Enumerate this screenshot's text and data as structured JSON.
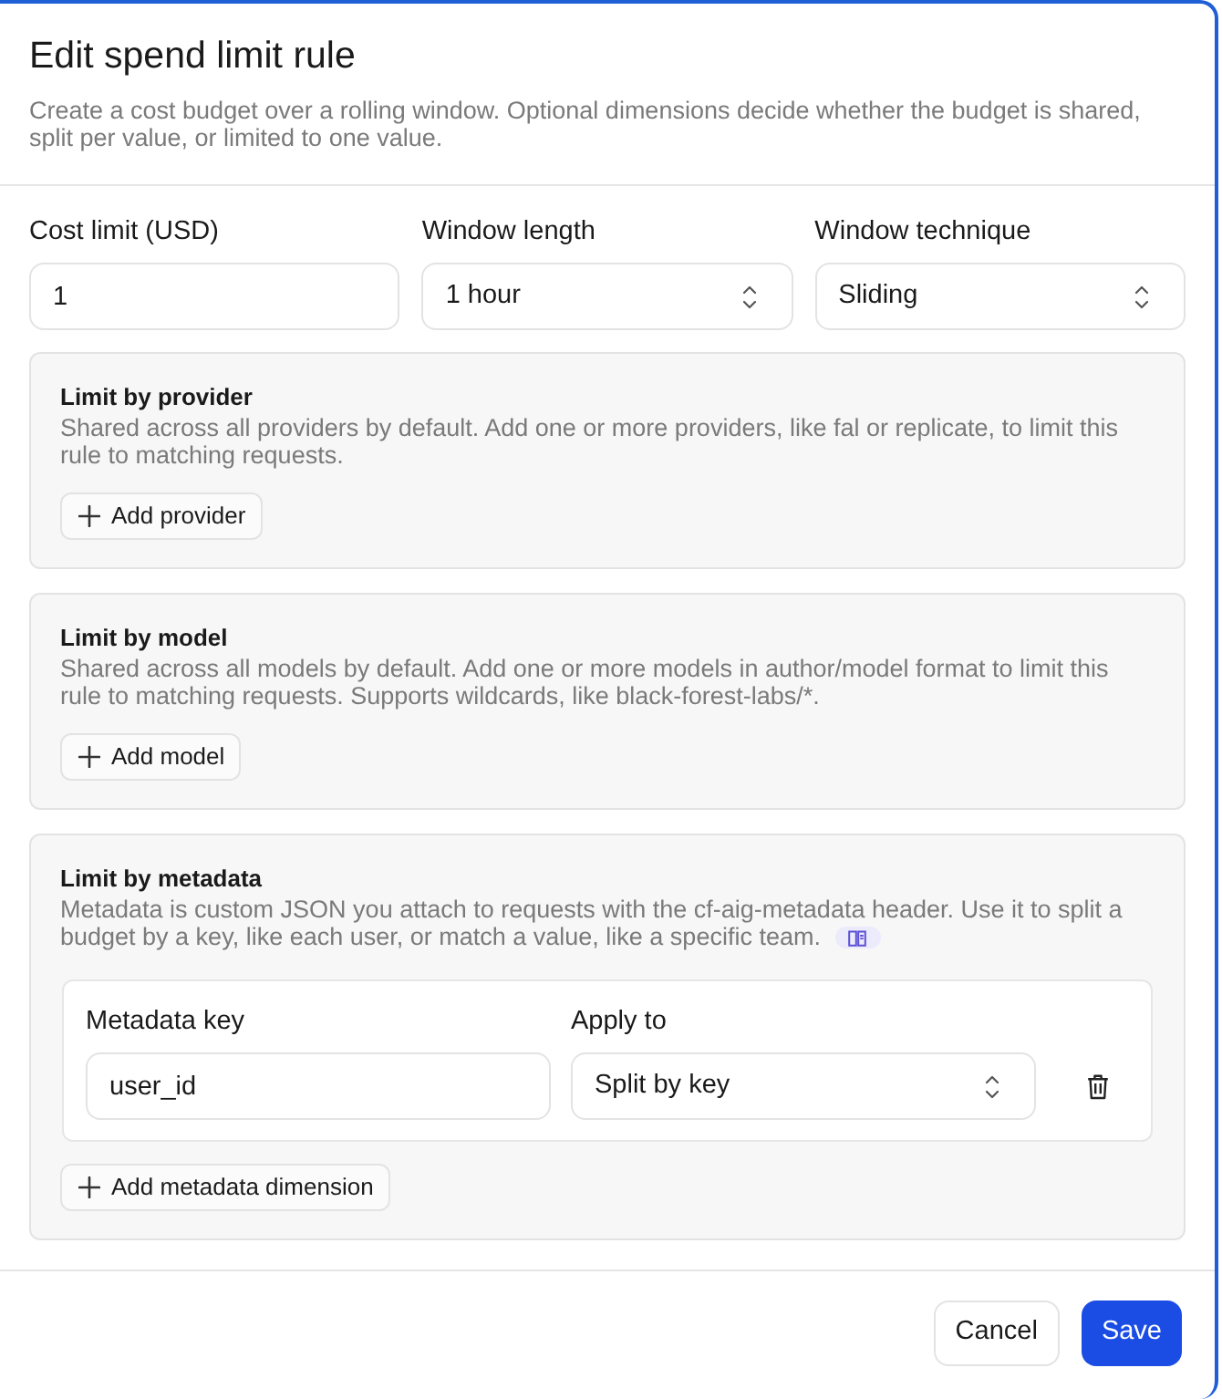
{
  "dialog": {
    "title": "Edit spend limit rule",
    "description": "Create a cost budget over a rolling window. Optional dimensions decide whether the budget is shared, split per value, or limited to one value."
  },
  "fields": [
    {
      "kind": "input",
      "label": "Cost limit (USD)",
      "value": "1"
    },
    {
      "kind": "select",
      "label": "Window length",
      "value": "1 hour"
    },
    {
      "kind": "select",
      "label": "Window technique",
      "value": "Sliding"
    }
  ],
  "sections": [
    {
      "title": "Limit by provider",
      "description": "Shared across all providers by default. Add one or more providers, like fal or replicate, to limit this rule to matching requests.",
      "add_button": "Add provider"
    },
    {
      "title": "Limit by model",
      "description": "Shared across all models by default. Add one or more models in author/model format to limit this rule to matching requests. Supports wildcards, like black-forest-labs/*.",
      "add_button": "Add model"
    },
    {
      "title": "Limit by metadata",
      "description": "Metadata is custom JSON you attach to requests with the cf-aig-metadata header. Use it to split a budget by a key, like each user, or match a value, like a specific team.",
      "docs_link": true,
      "dimensions": {
        "columns": [
          "Metadata key",
          "Apply to"
        ],
        "rows": [
          {
            "key": "user_id",
            "apply_to": "Split by key"
          }
        ]
      },
      "add_button": "Add metadata dimension"
    }
  ],
  "footer": {
    "buttons": [
      {
        "kind": "secondary",
        "label": "Cancel"
      },
      {
        "kind": "primary",
        "label": "Save"
      }
    ]
  }
}
